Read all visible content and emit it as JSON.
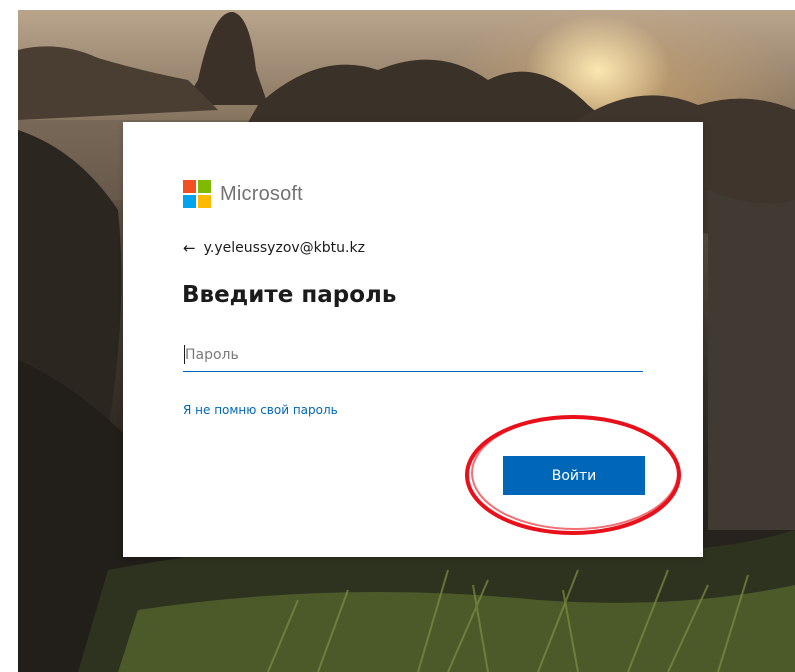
{
  "logo": {
    "brand_name": "Microsoft",
    "colors": [
      "#f25022",
      "#7fba00",
      "#00a4ef",
      "#ffb900"
    ]
  },
  "identity": {
    "back_icon": "←",
    "email": "y.yeleussyzov@kbtu.kz"
  },
  "form": {
    "title": "Введите пароль",
    "password_placeholder": "Пароль",
    "password_value": "",
    "forgot_link": "Я не помню свой пароль",
    "signin_label": "Войти"
  },
  "colors": {
    "accent": "#0067b8",
    "annotation": "#e8101a"
  }
}
